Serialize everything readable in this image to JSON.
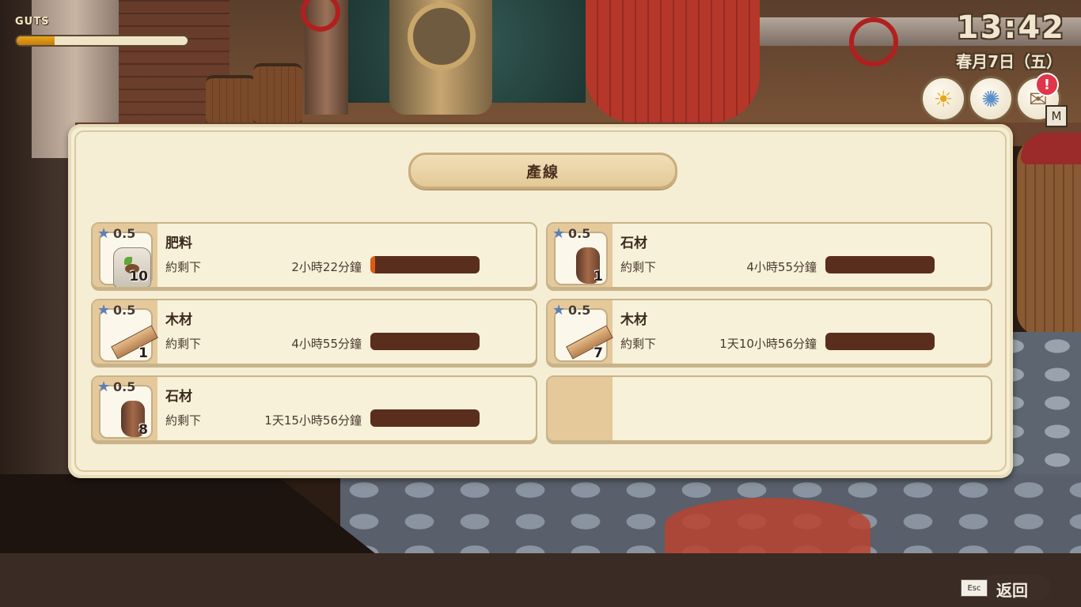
{
  "hud": {
    "guts_label": "GUTS",
    "guts_level": 0.22,
    "time": "13:42",
    "date": "春月7日（五）",
    "notice_badge": "!",
    "map_key": "M",
    "icons": [
      "sun-icon",
      "festival-icon",
      "notice-icon"
    ]
  },
  "panel": {
    "title": "產線",
    "slots": [
      {
        "name": "肥料",
        "level": "0.5",
        "qty": "10",
        "remain_label": "約剩下",
        "time": "2小時22分鐘",
        "progress": 0.04,
        "icon": "fertilizer-bag-icon"
      },
      {
        "name": "石材",
        "level": "0.5",
        "qty": "1",
        "remain_label": "約剩下",
        "time": "4小時55分鐘",
        "progress": 0,
        "icon": "stone-icon"
      },
      {
        "name": "木材",
        "level": "0.5",
        "qty": "1",
        "remain_label": "約剩下",
        "time": "4小時55分鐘",
        "progress": 0,
        "icon": "lumber-icon"
      },
      {
        "name": "木材",
        "level": "0.5",
        "qty": "7",
        "remain_label": "約剩下",
        "time": "1天10小時56分鐘",
        "progress": 0,
        "icon": "lumber-icon"
      },
      {
        "name": "石材",
        "level": "0.5",
        "qty": "8",
        "remain_label": "約剩下",
        "time": "1天15小時56分鐘",
        "progress": 0,
        "icon": "stone-icon"
      }
    ],
    "empty_slot": true
  },
  "footer": {
    "esc_key": "Esc",
    "back_label": "返回"
  },
  "colors": {
    "panel_bg": "#f5eed4",
    "progress_bar": "#5a2e1c",
    "progress_fill": "#e05a10",
    "guts_fill": "#e9a51a"
  }
}
